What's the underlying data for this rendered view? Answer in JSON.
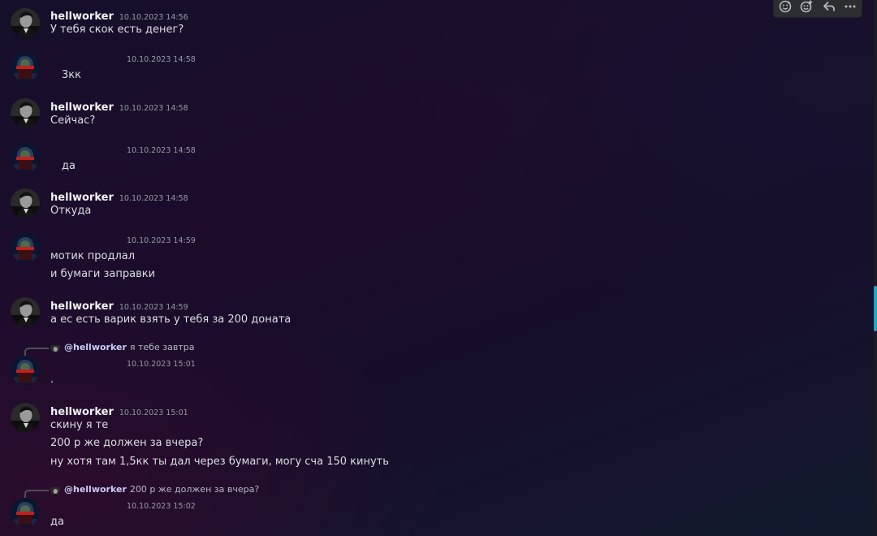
{
  "users": {
    "hellworker": {
      "name": "hellworker"
    }
  },
  "messages": [
    {
      "author": "hellworker",
      "timestamp": "10.10.2023 14:56",
      "lines": [
        "У тебя скок есть денег?"
      ]
    },
    {
      "author": "",
      "timestamp": "10.10.2023 14:58",
      "lines": [
        "3кк"
      ]
    },
    {
      "author": "hellworker",
      "timestamp": "10.10.2023 14:58",
      "lines": [
        "Сейчас?"
      ]
    },
    {
      "author": "",
      "timestamp": "10.10.2023 14:58",
      "lines": [
        "да"
      ]
    },
    {
      "author": "hellworker",
      "timestamp": "10.10.2023 14:58",
      "lines": [
        "Откуда"
      ]
    },
    {
      "author": "",
      "timestamp": "10.10.2023 14:59",
      "lines": [
        "мотик продлал",
        "и бумаги заправки"
      ]
    },
    {
      "author": "hellworker",
      "timestamp": "10.10.2023 14:59",
      "lines": [
        "а ес есть варик взять у тебя за 200 доната"
      ]
    },
    {
      "author": "",
      "timestamp": "10.10.2023 15:01",
      "lines": [
        "."
      ],
      "reply_to": {
        "mention": "@hellworker",
        "text": "я тебе завтра"
      }
    },
    {
      "author": "hellworker",
      "timestamp": "10.10.2023 15:01",
      "lines": [
        "скину я те",
        "200 р же должен за вчера?",
        "ну хотя там 1,5кк ты дал через бумаги, могу сча 150 кинуть"
      ]
    },
    {
      "author": "",
      "timestamp": "10.10.2023 15:02",
      "lines": [
        "да"
      ],
      "reply_to": {
        "mention": "@hellworker",
        "text": "200 р же должен за вчера?"
      }
    }
  ],
  "toolbar": {
    "icons": [
      "add-super-reaction-icon",
      "add-reaction-icon",
      "reply-icon",
      "more-icon"
    ]
  },
  "colors": {
    "username": "#f2f3f5",
    "timestamp": "#949ba4",
    "text": "#dbdee1",
    "mention": "#c9cdfb",
    "scroll_thumb": "#23a4c4"
  }
}
